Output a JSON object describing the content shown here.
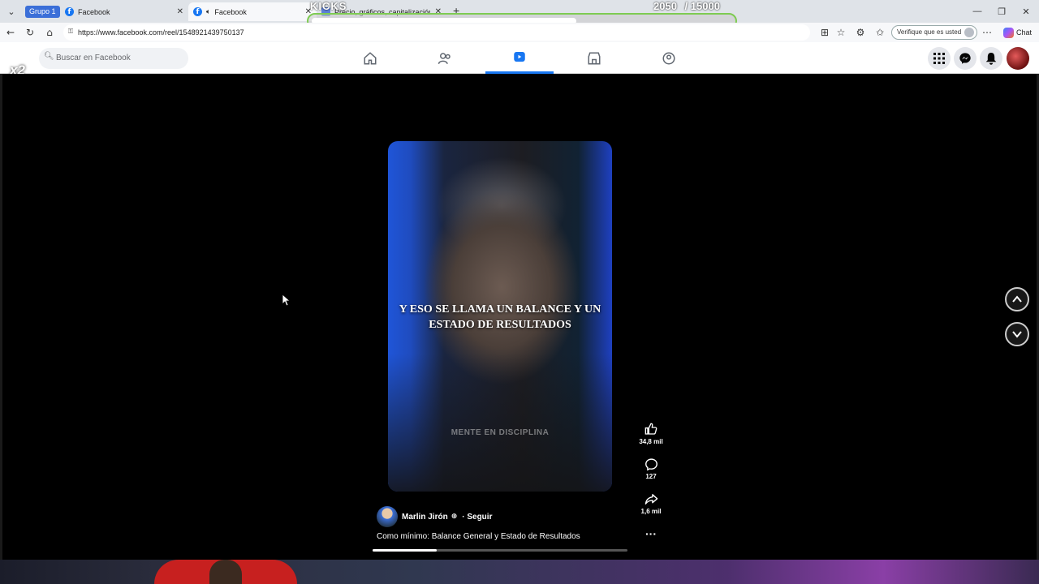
{
  "browser": {
    "tab_group": "Grupo 1",
    "tabs": [
      {
        "label": "Facebook"
      },
      {
        "label": "Facebook"
      },
      {
        "label": "Precio, gráficos, capitalización de"
      }
    ],
    "url": "https://www.facebook.com/reel/1548921439750137",
    "verify_label": "Verifique que es usted",
    "chat_label": "Chat"
  },
  "overlay": {
    "title": "KICKS",
    "current": "2050",
    "goal": "/ 15000",
    "progress": 0.137,
    "logo": "x2"
  },
  "fb": {
    "search_placeholder": "Buscar en Facebook",
    "nav": [
      "home-icon",
      "friends-icon",
      "reels-icon",
      "marketplace-icon",
      "groups-icon"
    ],
    "active_nav": "reels-icon",
    "accent": "#1877f2"
  },
  "reel": {
    "caption": "Y ESO SE LLAMA UN BALANCE Y UN ESTADO DE RESULTADOS",
    "watermark": "MENTE EN DISCIPLINA",
    "likes": "34,8 mil",
    "comments": "127",
    "shares": "1,6 mil",
    "author": "Marlin Jirón",
    "follow": "· Seguir",
    "description": "Como mínimo: Balance General y Estado de Resultados",
    "progress": 0.25
  }
}
